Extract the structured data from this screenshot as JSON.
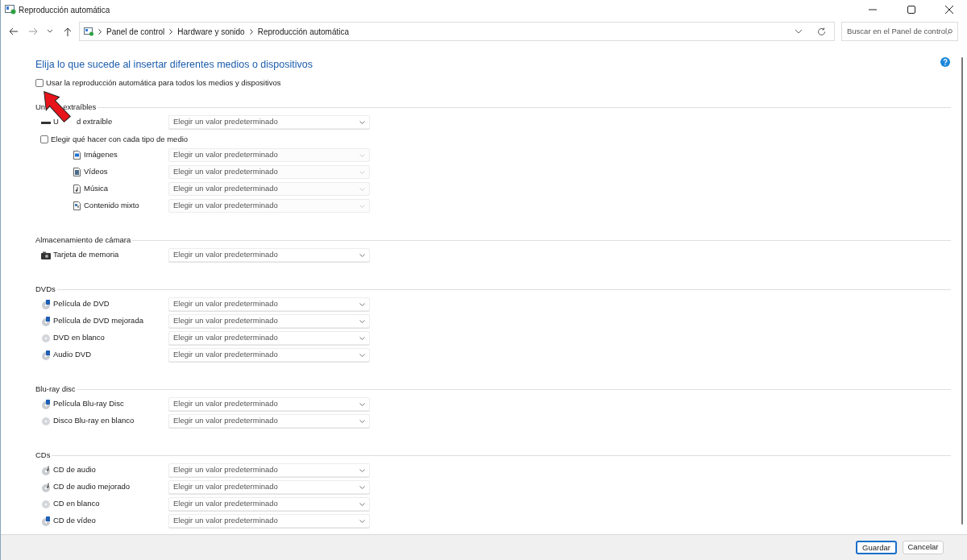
{
  "window": {
    "title": "Reproducción automática"
  },
  "address_bar": {
    "breadcrumbs": [
      "Panel de control",
      "Hardware y sonido",
      "Reproducción automática"
    ]
  },
  "search": {
    "placeholder": "Buscar en el Panel de control"
  },
  "heading": "Elija lo que sucede al insertar diferentes medios o dispositivos",
  "autoplay_all": {
    "label": "Usar la reproducción automática para todos los medios y dispositivos",
    "checked": false
  },
  "sections": [
    {
      "title_parts": [
        "Un",
        "extraíbles"
      ],
      "items": [
        {
          "kind": "drive",
          "label_parts": [
            "U",
            "d extraíble"
          ],
          "value": "Elegir un valor predeterminado",
          "disabled": false
        },
        {
          "kind": "checkbox",
          "label": "Elegir qué hacer con cada tipo de medio",
          "checked": false,
          "children": [
            {
              "kind": "image",
              "label": "Imágenes",
              "value": "Elegir un valor predeterminado",
              "disabled": true
            },
            {
              "kind": "video",
              "label": "Vídeos",
              "value": "Elegir un valor predeterminado",
              "disabled": true
            },
            {
              "kind": "music",
              "label": "Música",
              "value": "Elegir un valor predeterminado",
              "disabled": true
            },
            {
              "kind": "mixed",
              "label": "Contenido mixto",
              "value": "Elegir un valor predeterminado",
              "disabled": true
            }
          ]
        }
      ]
    },
    {
      "title_parts": [
        "Almacenamiento de cámara"
      ],
      "items": [
        {
          "kind": "camera",
          "label": "Tarjeta de memoria",
          "value": "Elegir un valor predeterminado",
          "disabled": false
        }
      ]
    },
    {
      "title_parts": [
        "DVDs"
      ],
      "items": [
        {
          "kind": "disc-video",
          "label": "Película de DVD",
          "value": "Elegir un valor predeterminado",
          "disabled": false
        },
        {
          "kind": "disc-video",
          "label": "Película de DVD mejorada",
          "value": "Elegir un valor predeterminado",
          "disabled": false
        },
        {
          "kind": "disc",
          "label": "DVD en blanco",
          "value": "Elegir un valor predeterminado",
          "disabled": false
        },
        {
          "kind": "disc-video",
          "label": "Audio DVD",
          "value": "Elegir un valor predeterminado",
          "disabled": false
        }
      ]
    },
    {
      "title_parts": [
        "Blu-ray disc"
      ],
      "items": [
        {
          "kind": "disc-video",
          "label": "Película Blu-ray Disc",
          "value": "Elegir un valor predeterminado",
          "disabled": false
        },
        {
          "kind": "disc",
          "label": "Disco Blu-ray en blanco",
          "value": "Elegir un valor predeterminado",
          "disabled": false
        }
      ]
    },
    {
      "title_parts": [
        "CDs"
      ],
      "items": [
        {
          "kind": "disc-music",
          "label": "CD de audio",
          "value": "Elegir un valor predeterminado",
          "disabled": false
        },
        {
          "kind": "disc-music",
          "label": "CD de audio mejorado",
          "value": "Elegir un valor predeterminado",
          "disabled": false
        },
        {
          "kind": "disc",
          "label": "CD en blanco",
          "value": "Elegir un valor predeterminado",
          "disabled": false
        },
        {
          "kind": "disc-video",
          "label": "CD de vídeo",
          "value": "Elegir un valor predeterminado",
          "disabled": false
        }
      ]
    }
  ],
  "buttons": [
    {
      "label": "Guardar",
      "focused": true
    },
    {
      "label": "Cancelar",
      "focused": false
    }
  ]
}
